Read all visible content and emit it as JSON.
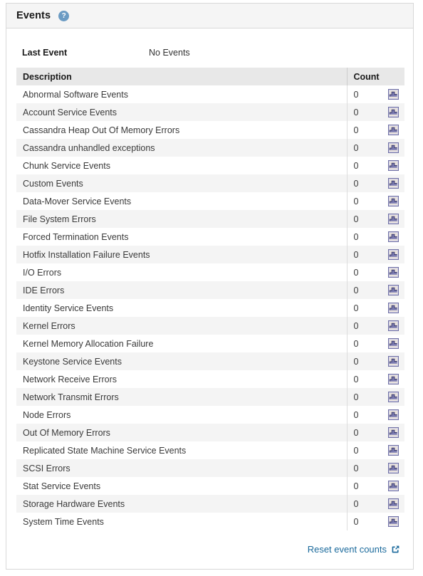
{
  "panel": {
    "title": "Events",
    "help_icon": "help-circle-icon"
  },
  "summary": {
    "label": "Last Event",
    "value": "No Events"
  },
  "table": {
    "columns": {
      "description": "Description",
      "count": "Count"
    },
    "row_icon": "chart-graph-icon",
    "rows": [
      {
        "description": "Abnormal Software Events",
        "count": "0"
      },
      {
        "description": "Account Service Events",
        "count": "0"
      },
      {
        "description": "Cassandra Heap Out Of Memory Errors",
        "count": "0"
      },
      {
        "description": "Cassandra unhandled exceptions",
        "count": "0"
      },
      {
        "description": "Chunk Service Events",
        "count": "0"
      },
      {
        "description": "Custom Events",
        "count": "0"
      },
      {
        "description": "Data-Mover Service Events",
        "count": "0"
      },
      {
        "description": "File System Errors",
        "count": "0"
      },
      {
        "description": "Forced Termination Events",
        "count": "0"
      },
      {
        "description": "Hotfix Installation Failure Events",
        "count": "0"
      },
      {
        "description": "I/O Errors",
        "count": "0"
      },
      {
        "description": "IDE Errors",
        "count": "0"
      },
      {
        "description": "Identity Service Events",
        "count": "0"
      },
      {
        "description": "Kernel Errors",
        "count": "0"
      },
      {
        "description": "Kernel Memory Allocation Failure",
        "count": "0"
      },
      {
        "description": "Keystone Service Events",
        "count": "0"
      },
      {
        "description": "Network Receive Errors",
        "count": "0"
      },
      {
        "description": "Network Transmit Errors",
        "count": "0"
      },
      {
        "description": "Node Errors",
        "count": "0"
      },
      {
        "description": "Out Of Memory Errors",
        "count": "0"
      },
      {
        "description": "Replicated State Machine Service Events",
        "count": "0"
      },
      {
        "description": "SCSI Errors",
        "count": "0"
      },
      {
        "description": "Stat Service Events",
        "count": "0"
      },
      {
        "description": "Storage Hardware Events",
        "count": "0"
      },
      {
        "description": "System Time Events",
        "count": "0"
      }
    ]
  },
  "footer": {
    "reset_label": "Reset event counts",
    "reset_icon": "external-link-icon"
  },
  "colors": {
    "link": "#1b6a9c",
    "help_icon_bg": "#6b9bc3",
    "header_bg": "#f5f5f5",
    "table_header_bg": "#e8e8e8",
    "stripe_bg": "#f4f4f4",
    "border": "#d8d8d8"
  }
}
